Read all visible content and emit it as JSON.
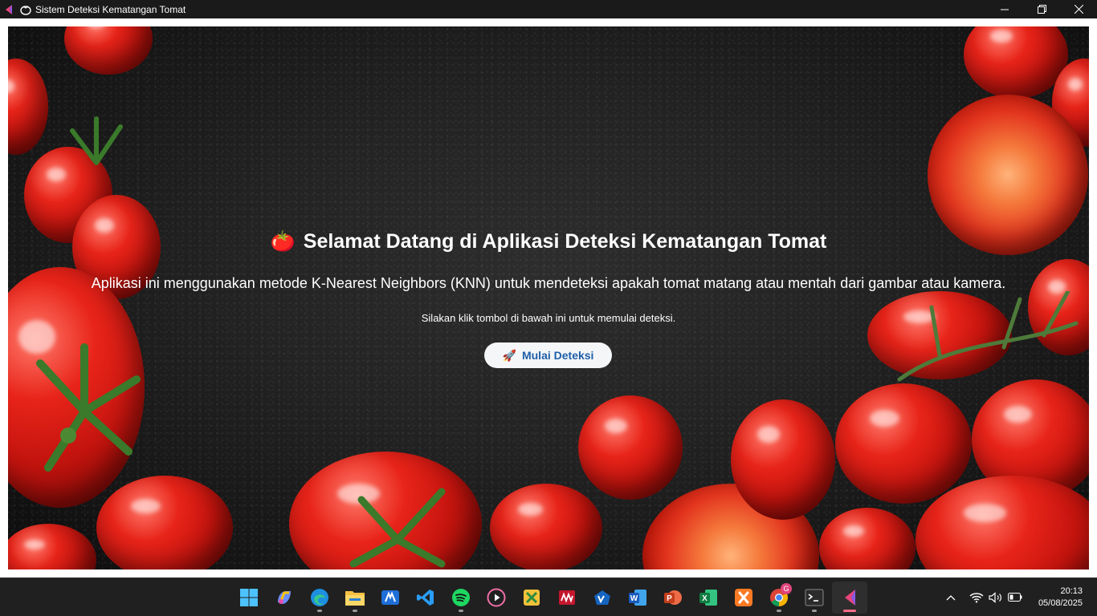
{
  "window": {
    "title": "Sistem Deteksi Kematangan Tomat",
    "title_icon": "tomato-icon",
    "controls": [
      "minimize-icon",
      "restore-icon",
      "close-icon"
    ]
  },
  "hero": {
    "emoji": "🍅",
    "title": "Selamat Datang di Aplikasi Deteksi Kematangan Tomat",
    "description": "Aplikasi ini menggunakan metode K-Nearest Neighbors (KNN) untuk mendeteksi apakah tomat matang atau mentah dari gambar atau kamera.",
    "hint": "Silakan klik tombol di bawah ini untuk memulai deteksi.",
    "button_icon": "🚀",
    "button_label": "Mulai Deteksi",
    "button_text_color": "#1f5fa8",
    "background_image": "dark-stone-with-red-tomatoes"
  },
  "taskbar": {
    "apps": [
      {
        "name": "windows-start",
        "icon": "windows-logo-icon"
      },
      {
        "name": "copilot",
        "icon": "copilot-icon"
      },
      {
        "name": "edge",
        "icon": "edge-icon",
        "running": true
      },
      {
        "name": "file-explorer",
        "icon": "folder-icon",
        "running": true
      },
      {
        "name": "app-blue",
        "icon": "blue-app-icon"
      },
      {
        "name": "vscode",
        "icon": "vscode-icon"
      },
      {
        "name": "spotify",
        "icon": "spotify-icon",
        "running": true
      },
      {
        "name": "media-player",
        "icon": "play-icon"
      },
      {
        "name": "app-green",
        "icon": "green-tools-icon"
      },
      {
        "name": "app-red",
        "icon": "red-app-icon"
      },
      {
        "name": "vpn",
        "icon": "vpn-icon"
      },
      {
        "name": "word",
        "icon": "word-icon"
      },
      {
        "name": "powerpoint",
        "icon": "powerpoint-icon"
      },
      {
        "name": "excel",
        "icon": "excel-icon"
      },
      {
        "name": "xampp",
        "icon": "xampp-icon"
      },
      {
        "name": "chrome",
        "icon": "chrome-icon",
        "badge": "G",
        "running": true
      },
      {
        "name": "terminal",
        "icon": "terminal-icon",
        "running": true
      },
      {
        "name": "flutter-app",
        "icon": "app-icon",
        "active": true
      }
    ],
    "tray": {
      "icons": [
        "chevron-up-icon",
        "wifi-icon",
        "volume-icon",
        "battery-icon"
      ],
      "time": "20:13",
      "date": "05/08/2025"
    }
  }
}
